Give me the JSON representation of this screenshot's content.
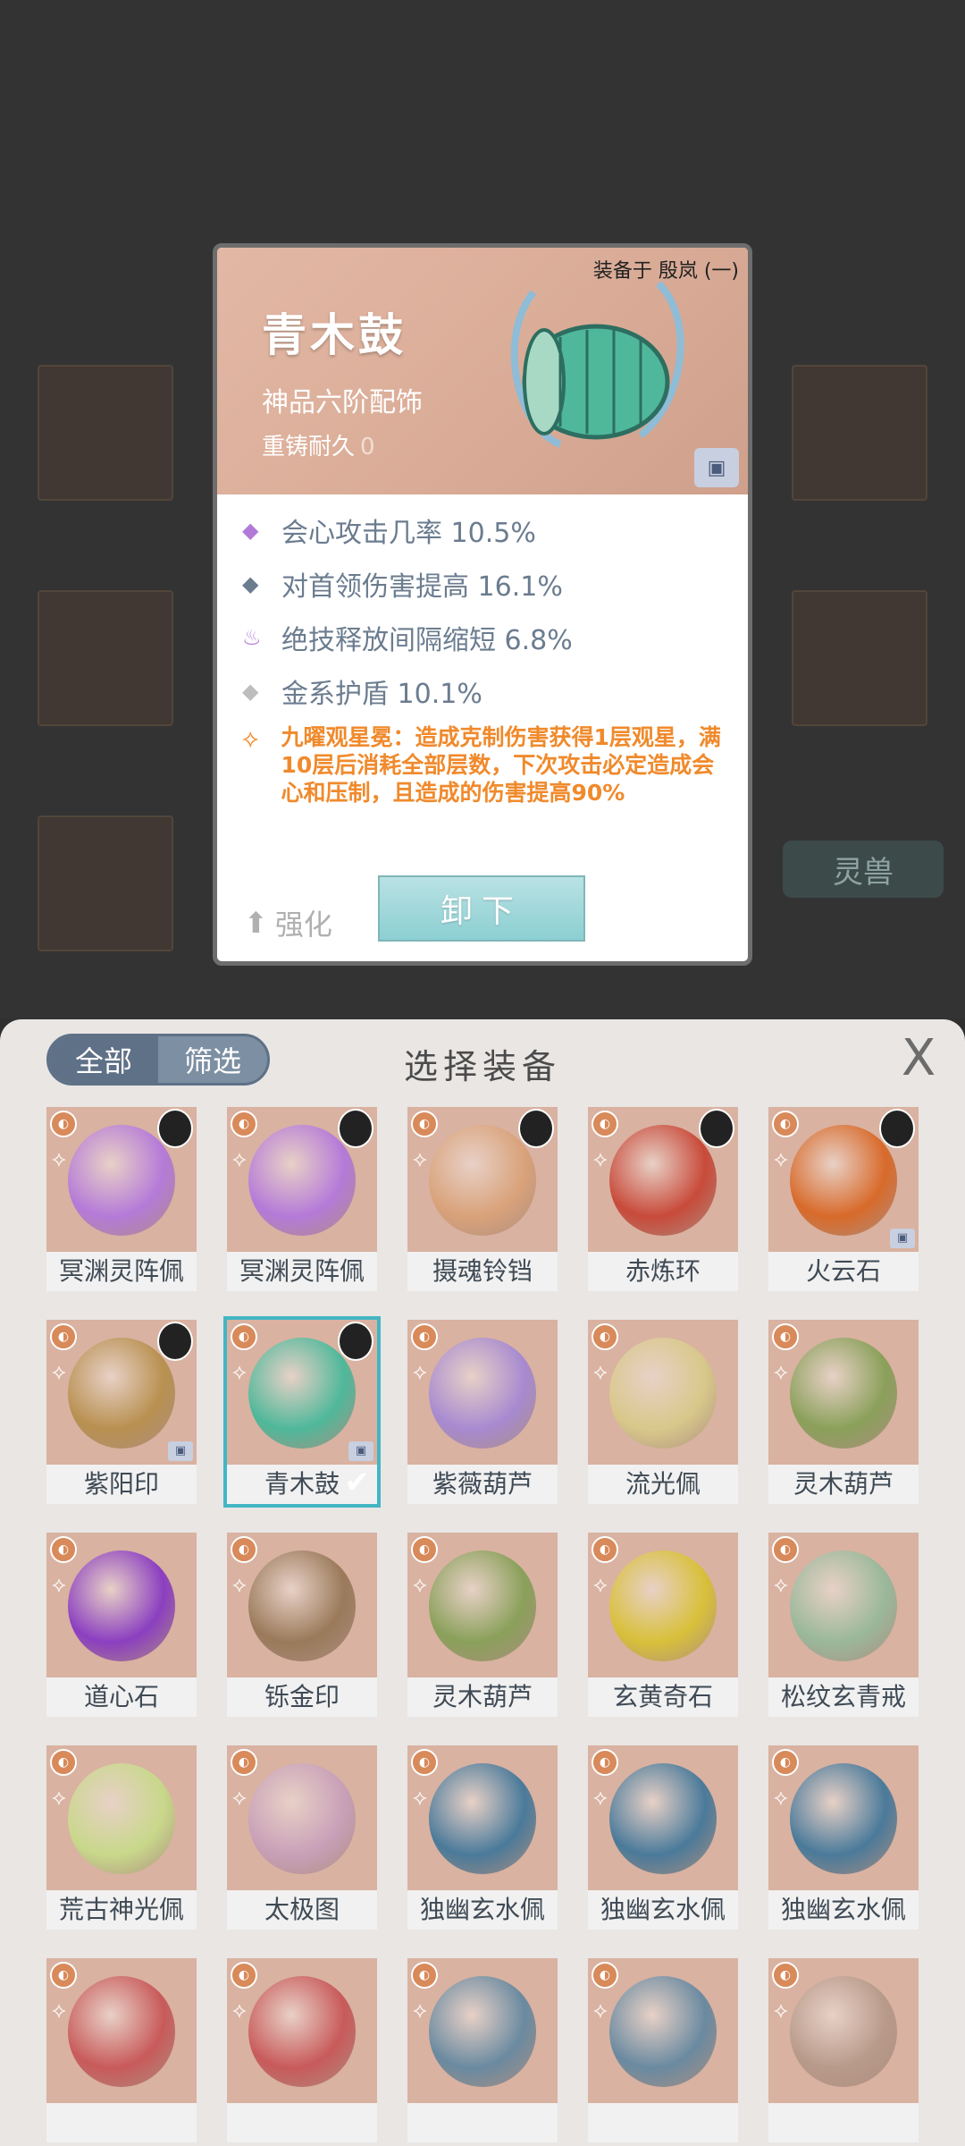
{
  "background": {
    "side_tab_label": "灵兽"
  },
  "detail": {
    "equipped_on": "装备于 殷岚 (一)",
    "name": "青木鼓",
    "type": "神品六阶配饰",
    "reforge_label": "重铸耐久",
    "reforge_value": "0",
    "stats": [
      {
        "text": "会心攻击几率 10.5%",
        "icon": "purple-diamond-icon",
        "color": "#b27ad8"
      },
      {
        "text": "对首领伤害提高 16.1%",
        "icon": "blue-diamond-icon",
        "color": "#6b7c8f"
      },
      {
        "text": "绝技释放间隔缩短 6.8%",
        "icon": "purple-flame-icon",
        "color": "#b27ad8"
      },
      {
        "text": "金系护盾 10.1%",
        "icon": "grey-diamond-icon",
        "color": "#bdbdbd"
      }
    ],
    "special": "九曜观星冕：造成克制伤害获得1层观星，满10层后消耗全部层数，下次攻击必定造成会心和压制，且造成的伤害提高90%",
    "strengthen_label": "强化",
    "unequip_label": "卸下"
  },
  "panel": {
    "title": "选择装备",
    "filter_all": "全部",
    "filter_screen": "筛选",
    "close_symbol": "X"
  },
  "items": [
    {
      "name": "冥渊灵阵佩",
      "color": "#b57ad8",
      "avatar": true
    },
    {
      "name": "冥渊灵阵佩",
      "color": "#b57ad8",
      "avatar": true
    },
    {
      "name": "摄魂铃铛",
      "color": "#d9a27a",
      "avatar": true
    },
    {
      "name": "赤炼环",
      "color": "#c84a3a",
      "avatar": true
    },
    {
      "name": "火云石",
      "color": "#d86a2a",
      "avatar": true,
      "chest": true
    },
    {
      "name": "紫阳印",
      "color": "#b89050",
      "avatar": true,
      "chest": true
    },
    {
      "name": "青木鼓",
      "color": "#4fb89a",
      "avatar": true,
      "chest": true,
      "selected": true
    },
    {
      "name": "紫薇葫芦",
      "color": "#a78ad0"
    },
    {
      "name": "流光佩",
      "color": "#d8c88a"
    },
    {
      "name": "灵木葫芦",
      "color": "#8aa05a"
    },
    {
      "name": "道心石",
      "color": "#8b3fc0"
    },
    {
      "name": "铄金印",
      "color": "#9a7a5a"
    },
    {
      "name": "灵木葫芦",
      "color": "#8aa05a"
    },
    {
      "name": "玄黄奇石",
      "color": "#d8c03a"
    },
    {
      "name": "松纹玄青戒",
      "color": "#9ab89a"
    },
    {
      "name": "荒古神光佩",
      "color": "#c8d88a"
    },
    {
      "name": "太极图",
      "color": "#c8a0b8"
    },
    {
      "name": "独幽玄水佩",
      "color": "#4a7a9a"
    },
    {
      "name": "独幽玄水佩",
      "color": "#4a7a9a"
    },
    {
      "name": "独幽玄水佩",
      "color": "#4a7a9a"
    },
    {
      "name": "",
      "color": "#c85a5a"
    },
    {
      "name": "",
      "color": "#c85a5a"
    },
    {
      "name": "",
      "color": "#6a8aa0"
    },
    {
      "name": "",
      "color": "#6a8aa0"
    },
    {
      "name": "",
      "color": "#b89a8a"
    }
  ]
}
